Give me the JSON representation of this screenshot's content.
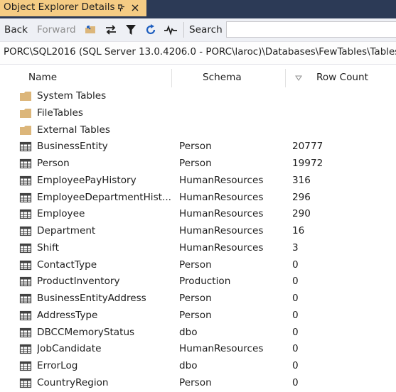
{
  "tab": {
    "title": "Object Explorer Details"
  },
  "toolbar": {
    "back": "Back",
    "forward": "Forward",
    "search_label": "Search",
    "search_value": ""
  },
  "path": "PORC\\SQL2016 (SQL Server 13.0.4206.0 - PORC\\laroc)\\Databases\\FewTables\\Tables",
  "columns": {
    "name": "Name",
    "schema": "Schema",
    "rows": "Row Count"
  },
  "items": [
    {
      "icon": "folder-icon",
      "name": "System Tables",
      "schema": "",
      "rows": ""
    },
    {
      "icon": "folder-icon",
      "name": "FileTables",
      "schema": "",
      "rows": ""
    },
    {
      "icon": "folder-icon",
      "name": "External Tables",
      "schema": "",
      "rows": ""
    },
    {
      "icon": "table-icon",
      "name": "BusinessEntity",
      "schema": "Person",
      "rows": "20777"
    },
    {
      "icon": "table-icon",
      "name": "Person",
      "schema": "Person",
      "rows": "19972"
    },
    {
      "icon": "table-icon",
      "name": "EmployeePayHistory",
      "schema": "HumanResources",
      "rows": "316"
    },
    {
      "icon": "table-icon",
      "name": "EmployeeDepartmentHist...",
      "schema": "HumanResources",
      "rows": "296"
    },
    {
      "icon": "table-icon",
      "name": "Employee",
      "schema": "HumanResources",
      "rows": "290"
    },
    {
      "icon": "table-icon",
      "name": "Department",
      "schema": "HumanResources",
      "rows": "16"
    },
    {
      "icon": "table-icon",
      "name": "Shift",
      "schema": "HumanResources",
      "rows": "3"
    },
    {
      "icon": "table-icon",
      "name": "ContactType",
      "schema": "Person",
      "rows": "0"
    },
    {
      "icon": "table-icon",
      "name": "ProductInventory",
      "schema": "Production",
      "rows": "0"
    },
    {
      "icon": "table-icon",
      "name": "BusinessEntityAddress",
      "schema": "Person",
      "rows": "0"
    },
    {
      "icon": "table-icon",
      "name": "AddressType",
      "schema": "Person",
      "rows": "0"
    },
    {
      "icon": "table-icon",
      "name": "DBCCMemoryStatus",
      "schema": "dbo",
      "rows": "0"
    },
    {
      "icon": "table-icon",
      "name": "JobCandidate",
      "schema": "HumanResources",
      "rows": "0"
    },
    {
      "icon": "table-icon",
      "name": "ErrorLog",
      "schema": "dbo",
      "rows": "0"
    },
    {
      "icon": "table-icon",
      "name": "CountryRegion",
      "schema": "Person",
      "rows": "0"
    }
  ],
  "colors": {
    "tab_bg": "#f5cc84",
    "tabstrip_bg": "#2c3a56",
    "toolbar_bg": "#eef0f5",
    "folder": "#dcb67a",
    "table_icon": "#424242"
  }
}
